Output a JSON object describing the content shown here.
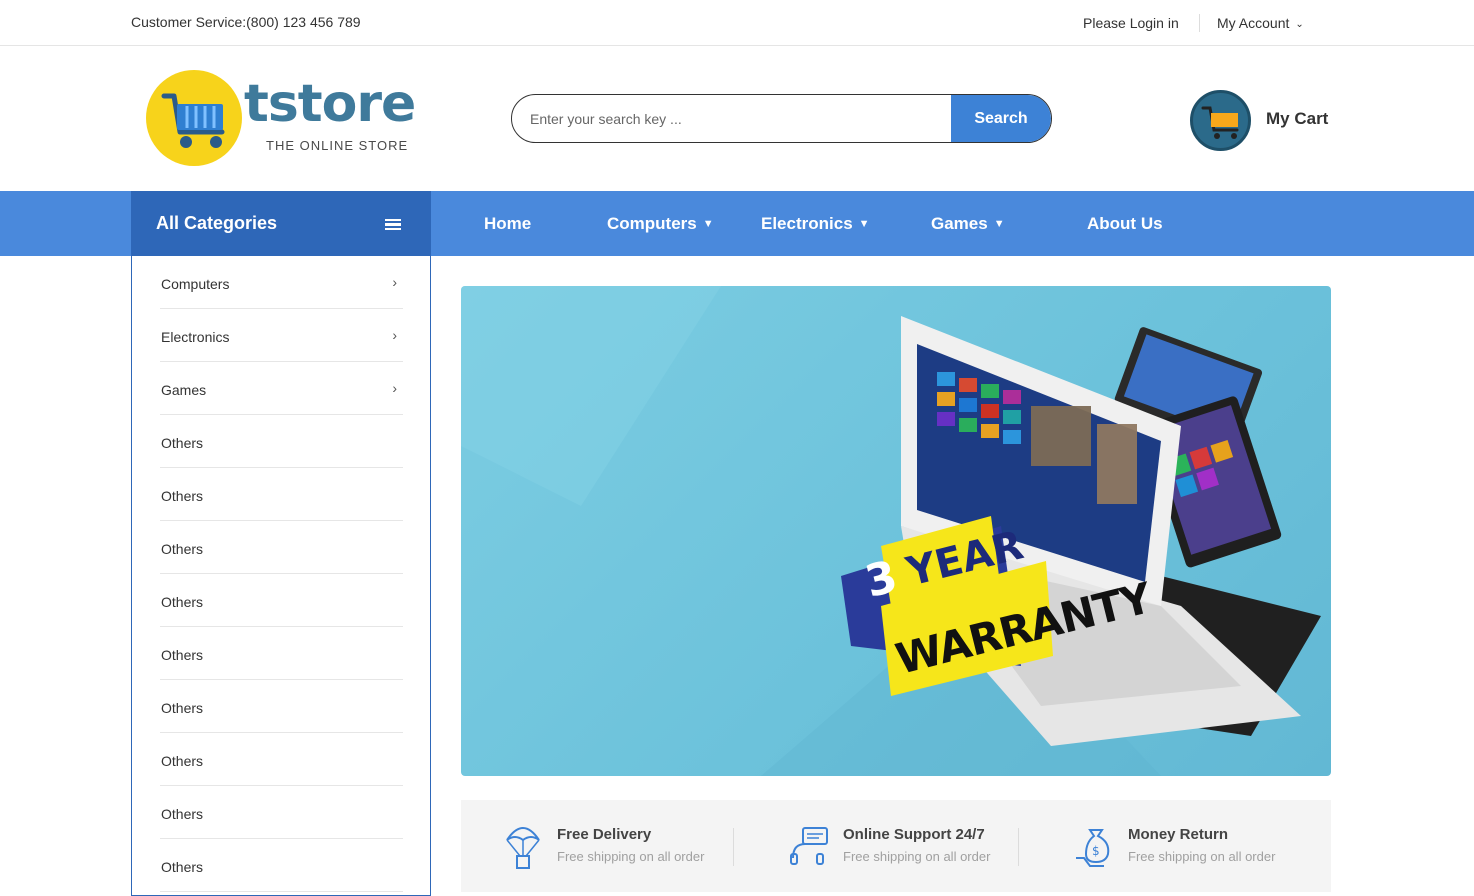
{
  "topbar": {
    "customer_service": "Customer Service:(800) 123 456 789",
    "login": "Please Login in",
    "account": "My Account"
  },
  "logo": {
    "brand": "tstore",
    "tagline": "THE ONLINE STORE"
  },
  "search": {
    "placeholder": "Enter your search key ...",
    "button": "Search"
  },
  "cart": {
    "label": "My Cart"
  },
  "nav": {
    "all_categories": "All Categories",
    "items": [
      {
        "label": "Home",
        "dropdown": false
      },
      {
        "label": "Computers",
        "dropdown": true
      },
      {
        "label": "Electronics",
        "dropdown": true
      },
      {
        "label": "Games",
        "dropdown": true
      },
      {
        "label": "About Us",
        "dropdown": false
      }
    ]
  },
  "sidebar": {
    "items": [
      {
        "label": "Computers",
        "has_sub": true
      },
      {
        "label": "Electronics",
        "has_sub": true
      },
      {
        "label": "Games",
        "has_sub": true
      },
      {
        "label": "Others",
        "has_sub": false
      },
      {
        "label": "Others",
        "has_sub": false
      },
      {
        "label": "Others",
        "has_sub": false
      },
      {
        "label": "Others",
        "has_sub": false
      },
      {
        "label": "Others",
        "has_sub": false
      },
      {
        "label": "Others",
        "has_sub": false
      },
      {
        "label": "Others",
        "has_sub": false
      },
      {
        "label": "Others",
        "has_sub": false
      },
      {
        "label": "Others",
        "has_sub": false
      }
    ]
  },
  "banner": {
    "badge_number": "3",
    "badge_year": "YEAR",
    "badge_word": "WARRANTY"
  },
  "features": [
    {
      "icon": "parachute-delivery-icon",
      "title": "Free Delivery",
      "subtitle": "Free shipping on all order"
    },
    {
      "icon": "support-headset-icon",
      "title": "Online Support 24/7",
      "subtitle": "Free shipping on all order"
    },
    {
      "icon": "money-bag-hand-icon",
      "title": "Money Return",
      "subtitle": "Free shipping on all order"
    }
  ],
  "colors": {
    "primary": "#4a89dc",
    "primary_dark": "#2e67b8",
    "logo_yellow": "#f7d31b",
    "logo_blue": "#3f7a9b",
    "banner_bg": "#6cc2db"
  }
}
